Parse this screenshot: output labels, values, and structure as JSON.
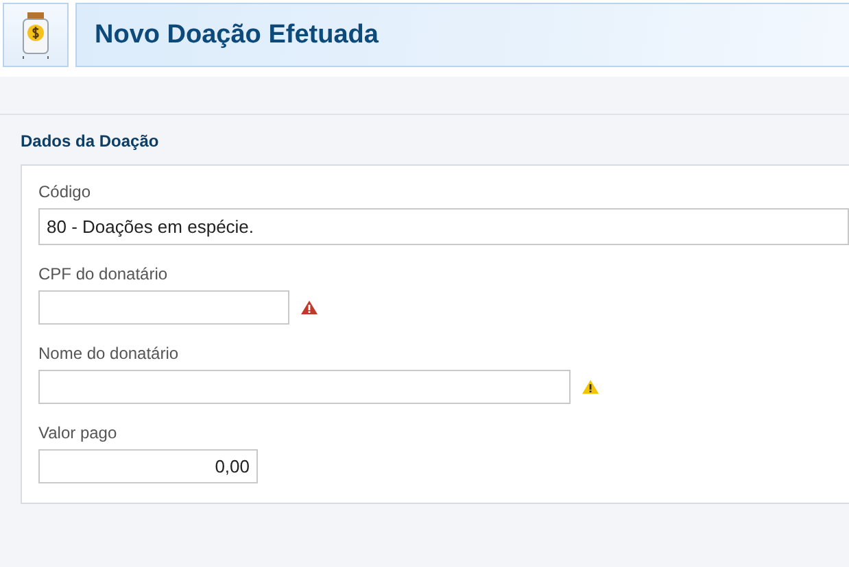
{
  "header": {
    "title": "Novo Doação Efetuada"
  },
  "section": {
    "title": "Dados da Doação"
  },
  "fields": [
    {
      "label": "Código",
      "value": "80 - Doações em espécie.",
      "kind": "wide",
      "error": false,
      "warning": false
    },
    {
      "label": "CPF do donatário",
      "kind": "short",
      "error": true,
      "warning": false
    },
    {
      "label": "Nome do donatário",
      "kind": "medium",
      "error": false,
      "warning": true
    },
    {
      "label": "Valor pago",
      "value": "0,00",
      "kind": "money",
      "error": false,
      "warning": false
    }
  ]
}
